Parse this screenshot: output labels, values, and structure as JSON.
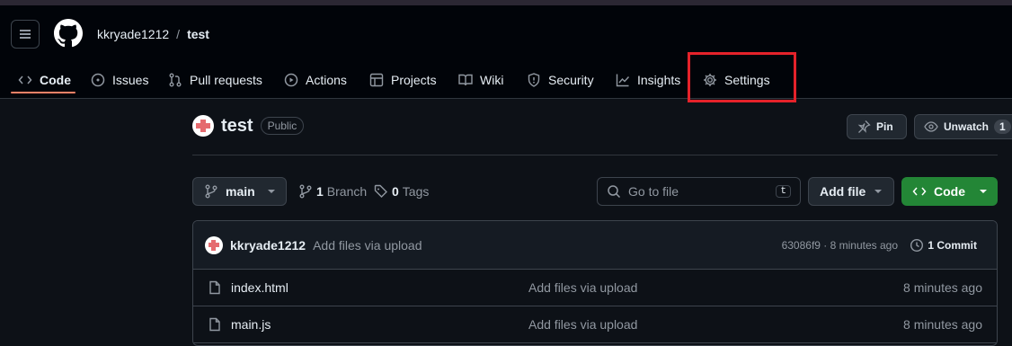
{
  "header": {
    "owner": "kkryade1212",
    "separator": "/",
    "repo": "test"
  },
  "tabs": [
    {
      "label": "Code",
      "icon": "code-icon",
      "active": true
    },
    {
      "label": "Issues",
      "icon": "issue-opened-icon"
    },
    {
      "label": "Pull requests",
      "icon": "git-pull-request-icon"
    },
    {
      "label": "Actions",
      "icon": "play-icon"
    },
    {
      "label": "Projects",
      "icon": "table-icon"
    },
    {
      "label": "Wiki",
      "icon": "book-icon"
    },
    {
      "label": "Security",
      "icon": "shield-icon"
    },
    {
      "label": "Insights",
      "icon": "graph-icon"
    },
    {
      "label": "Settings",
      "icon": "gear-icon",
      "highlighted": true
    }
  ],
  "colors": {
    "highlight": "#e5222a",
    "active_tab_underline": "#f78166",
    "code_button": "#238636"
  },
  "repo_header": {
    "name": "test",
    "visibility": "Public",
    "pin_label": "Pin",
    "unwatch_label": "Unwatch",
    "watch_count": "1"
  },
  "toolbar": {
    "branch": "main",
    "branches_count": "1",
    "branches_label": "Branch",
    "tags_count": "0",
    "tags_label": "Tags",
    "search_placeholder": "Go to file",
    "search_shortcut": "t",
    "add_file_label": "Add file",
    "code_label": "Code"
  },
  "latest_commit": {
    "author": "kkryade1212",
    "message": "Add files via upload",
    "meta": "63086f9 · 8 minutes ago",
    "commits_label": "1 Commit"
  },
  "files": [
    {
      "name": "index.html",
      "message": "Add files via upload",
      "date": "8 minutes ago"
    },
    {
      "name": "main.js",
      "message": "Add files via upload",
      "date": "8 minutes ago"
    }
  ]
}
